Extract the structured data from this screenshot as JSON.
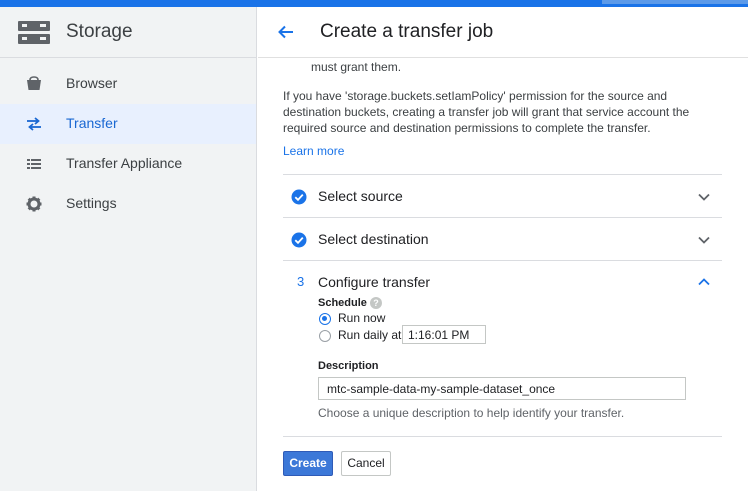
{
  "sidebar": {
    "title": "Storage",
    "items": [
      {
        "label": "Browser",
        "icon": "bucket-icon"
      },
      {
        "label": "Transfer",
        "icon": "transfer-arrows-icon",
        "active": true
      },
      {
        "label": "Transfer Appliance",
        "icon": "list-icon"
      },
      {
        "label": "Settings",
        "icon": "gear-icon"
      }
    ]
  },
  "header": {
    "title": "Create a transfer job",
    "back_icon": "arrow-back-icon"
  },
  "content": {
    "cut_text": "must grant them.",
    "paragraph": "If you have 'storage.buckets.setIamPolicy' permission for the source and destination buckets, creating a transfer job will grant that service account the required source and destination permissions to complete the transfer.",
    "learn_more": "Learn more"
  },
  "steps": [
    {
      "title": "Select source",
      "status": "complete"
    },
    {
      "title": "Select destination",
      "status": "complete"
    },
    {
      "number": "3",
      "title": "Configure transfer",
      "status": "active"
    }
  ],
  "configure": {
    "schedule_label": "Schedule",
    "help_glyph": "?",
    "run_now_label": "Run now",
    "run_daily_label": "Run daily at",
    "time_value": "1:16:01 PM",
    "description_label": "Description",
    "description_value": "mtc-sample-data-my-sample-dataset_once",
    "hint": "Choose a unique description to help identify your transfer."
  },
  "actions": {
    "create_label": "Create",
    "cancel_label": "Cancel"
  },
  "colors": {
    "accent": "#1a73e8",
    "active_nav_bg": "#e8f0fe",
    "sidebar_bg": "#f1f3f4",
    "button_primary": "#3c78d8"
  }
}
